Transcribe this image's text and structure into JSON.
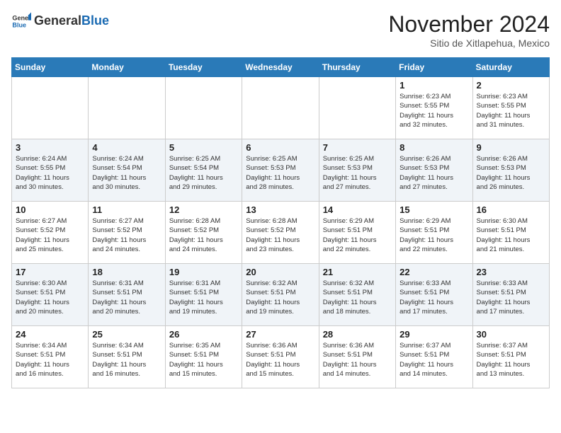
{
  "header": {
    "logo_general": "General",
    "logo_blue": "Blue",
    "month_title": "November 2024",
    "subtitle": "Sitio de Xitlapehua, Mexico"
  },
  "weekdays": [
    "Sunday",
    "Monday",
    "Tuesday",
    "Wednesday",
    "Thursday",
    "Friday",
    "Saturday"
  ],
  "weeks": [
    [
      {
        "day": "",
        "info": ""
      },
      {
        "day": "",
        "info": ""
      },
      {
        "day": "",
        "info": ""
      },
      {
        "day": "",
        "info": ""
      },
      {
        "day": "",
        "info": ""
      },
      {
        "day": "1",
        "info": "Sunrise: 6:23 AM\nSunset: 5:55 PM\nDaylight: 11 hours\nand 32 minutes."
      },
      {
        "day": "2",
        "info": "Sunrise: 6:23 AM\nSunset: 5:55 PM\nDaylight: 11 hours\nand 31 minutes."
      }
    ],
    [
      {
        "day": "3",
        "info": "Sunrise: 6:24 AM\nSunset: 5:55 PM\nDaylight: 11 hours\nand 30 minutes."
      },
      {
        "day": "4",
        "info": "Sunrise: 6:24 AM\nSunset: 5:54 PM\nDaylight: 11 hours\nand 30 minutes."
      },
      {
        "day": "5",
        "info": "Sunrise: 6:25 AM\nSunset: 5:54 PM\nDaylight: 11 hours\nand 29 minutes."
      },
      {
        "day": "6",
        "info": "Sunrise: 6:25 AM\nSunset: 5:53 PM\nDaylight: 11 hours\nand 28 minutes."
      },
      {
        "day": "7",
        "info": "Sunrise: 6:25 AM\nSunset: 5:53 PM\nDaylight: 11 hours\nand 27 minutes."
      },
      {
        "day": "8",
        "info": "Sunrise: 6:26 AM\nSunset: 5:53 PM\nDaylight: 11 hours\nand 27 minutes."
      },
      {
        "day": "9",
        "info": "Sunrise: 6:26 AM\nSunset: 5:53 PM\nDaylight: 11 hours\nand 26 minutes."
      }
    ],
    [
      {
        "day": "10",
        "info": "Sunrise: 6:27 AM\nSunset: 5:52 PM\nDaylight: 11 hours\nand 25 minutes."
      },
      {
        "day": "11",
        "info": "Sunrise: 6:27 AM\nSunset: 5:52 PM\nDaylight: 11 hours\nand 24 minutes."
      },
      {
        "day": "12",
        "info": "Sunrise: 6:28 AM\nSunset: 5:52 PM\nDaylight: 11 hours\nand 24 minutes."
      },
      {
        "day": "13",
        "info": "Sunrise: 6:28 AM\nSunset: 5:52 PM\nDaylight: 11 hours\nand 23 minutes."
      },
      {
        "day": "14",
        "info": "Sunrise: 6:29 AM\nSunset: 5:51 PM\nDaylight: 11 hours\nand 22 minutes."
      },
      {
        "day": "15",
        "info": "Sunrise: 6:29 AM\nSunset: 5:51 PM\nDaylight: 11 hours\nand 22 minutes."
      },
      {
        "day": "16",
        "info": "Sunrise: 6:30 AM\nSunset: 5:51 PM\nDaylight: 11 hours\nand 21 minutes."
      }
    ],
    [
      {
        "day": "17",
        "info": "Sunrise: 6:30 AM\nSunset: 5:51 PM\nDaylight: 11 hours\nand 20 minutes."
      },
      {
        "day": "18",
        "info": "Sunrise: 6:31 AM\nSunset: 5:51 PM\nDaylight: 11 hours\nand 20 minutes."
      },
      {
        "day": "19",
        "info": "Sunrise: 6:31 AM\nSunset: 5:51 PM\nDaylight: 11 hours\nand 19 minutes."
      },
      {
        "day": "20",
        "info": "Sunrise: 6:32 AM\nSunset: 5:51 PM\nDaylight: 11 hours\nand 19 minutes."
      },
      {
        "day": "21",
        "info": "Sunrise: 6:32 AM\nSunset: 5:51 PM\nDaylight: 11 hours\nand 18 minutes."
      },
      {
        "day": "22",
        "info": "Sunrise: 6:33 AM\nSunset: 5:51 PM\nDaylight: 11 hours\nand 17 minutes."
      },
      {
        "day": "23",
        "info": "Sunrise: 6:33 AM\nSunset: 5:51 PM\nDaylight: 11 hours\nand 17 minutes."
      }
    ],
    [
      {
        "day": "24",
        "info": "Sunrise: 6:34 AM\nSunset: 5:51 PM\nDaylight: 11 hours\nand 16 minutes."
      },
      {
        "day": "25",
        "info": "Sunrise: 6:34 AM\nSunset: 5:51 PM\nDaylight: 11 hours\nand 16 minutes."
      },
      {
        "day": "26",
        "info": "Sunrise: 6:35 AM\nSunset: 5:51 PM\nDaylight: 11 hours\nand 15 minutes."
      },
      {
        "day": "27",
        "info": "Sunrise: 6:36 AM\nSunset: 5:51 PM\nDaylight: 11 hours\nand 15 minutes."
      },
      {
        "day": "28",
        "info": "Sunrise: 6:36 AM\nSunset: 5:51 PM\nDaylight: 11 hours\nand 14 minutes."
      },
      {
        "day": "29",
        "info": "Sunrise: 6:37 AM\nSunset: 5:51 PM\nDaylight: 11 hours\nand 14 minutes."
      },
      {
        "day": "30",
        "info": "Sunrise: 6:37 AM\nSunset: 5:51 PM\nDaylight: 11 hours\nand 13 minutes."
      }
    ]
  ]
}
